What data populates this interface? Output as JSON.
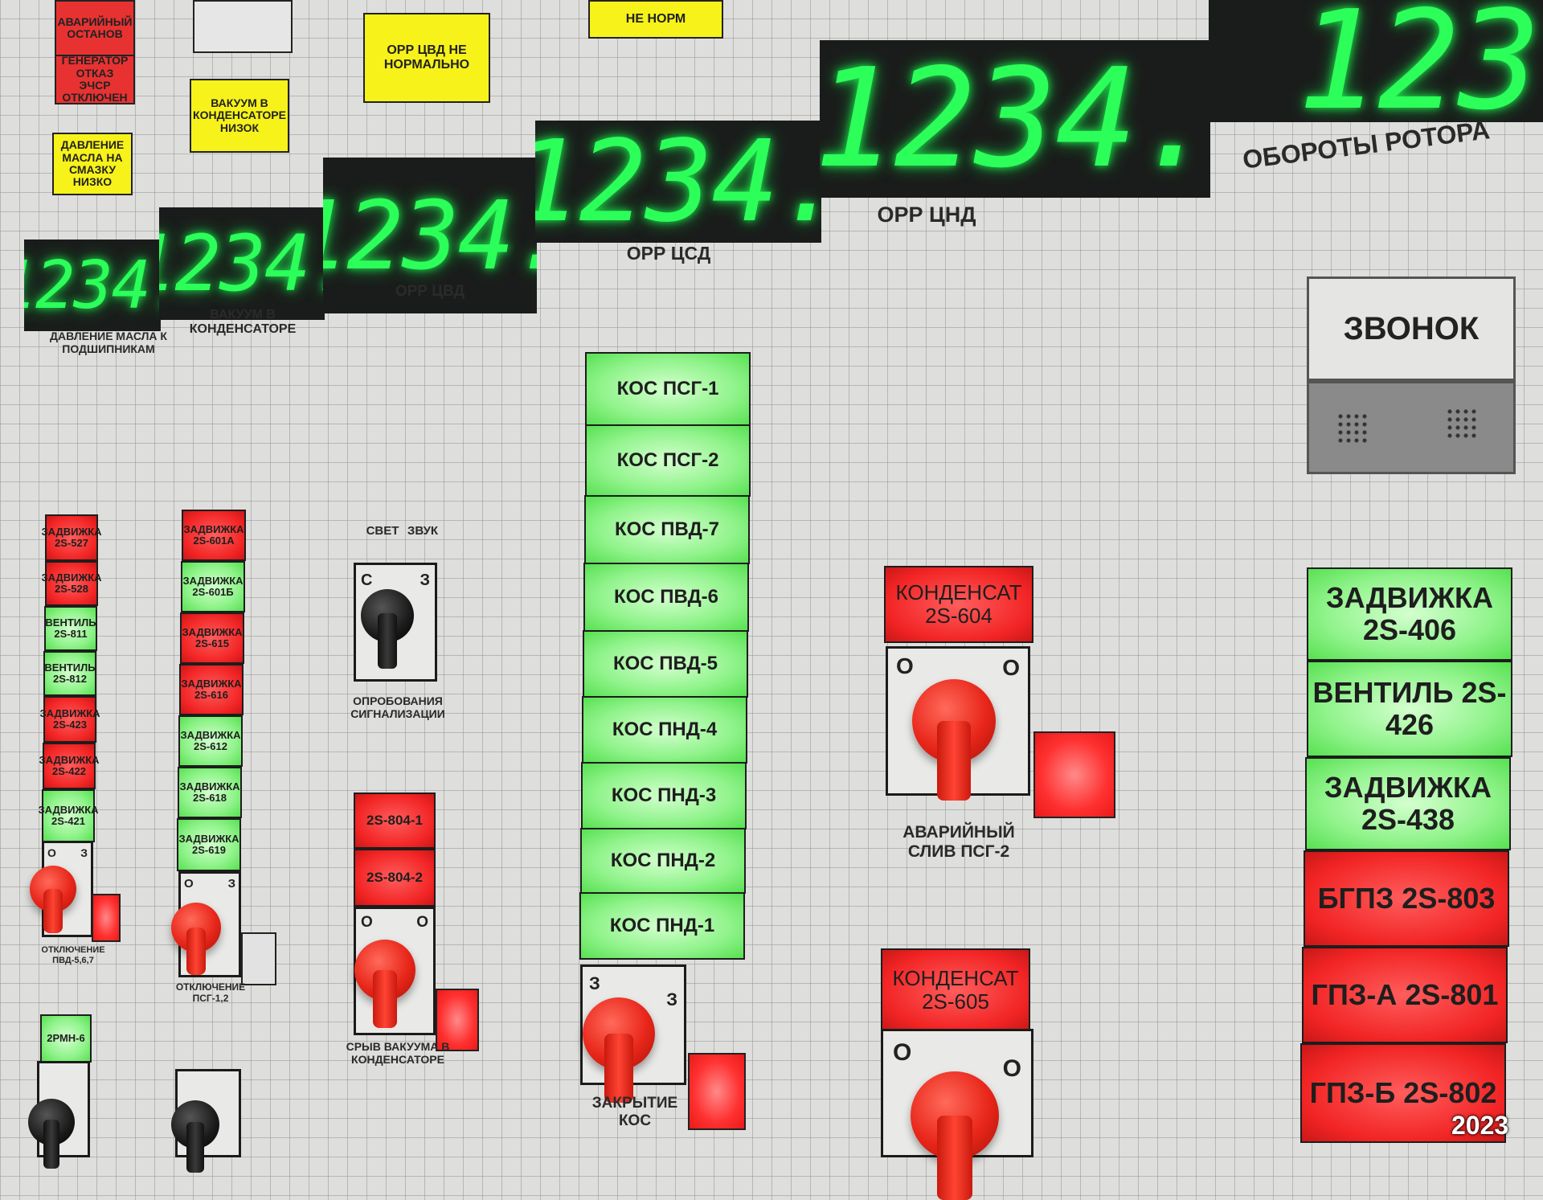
{
  "alarms": {
    "a1": "АВАРИЙНЫЙ ОСТАНОВ",
    "a2": "ГЕНЕРАТОР ОТКАЗ ЭЧСР ОТКЛЮЧЕН",
    "a3": "ДАВЛЕНИЕ МАСЛА НА СМАЗКУ НИЗКО",
    "a4": "ВАКУУМ В КОНДЕНСАТОРЕ НИЗОК",
    "a5": "ОРР ЦВД НЕ НОРМАЛЬНО",
    "a6": "НЕ НОРМ"
  },
  "displays": [
    {
      "value": "1234.",
      "caption": "ДАВЛЕНИЕ МАСЛА К ПОДШИПНИКАМ"
    },
    {
      "value": "1234.",
      "caption": "ВАКУУМ В КОНДЕНСАТОРЕ"
    },
    {
      "value": "1234.",
      "caption": "ОРР ЦВД"
    },
    {
      "value": "1234.",
      "caption": "ОРР ЦСД"
    },
    {
      "value": "1234.",
      "caption": "ОРР ЦНД"
    },
    {
      "value": "123",
      "caption": "ОБОРОТЫ РОТОРА"
    }
  ],
  "col1": {
    "tiles": [
      "ЗАДВИЖКА 2S-527",
      "ЗАДВИЖКА 2S-528",
      "ВЕНТИЛЬ 2S-811",
      "ВЕНТИЛЬ 2S-812",
      "ЗАДВИЖКА 2S-423",
      "ЗАДВИЖКА 2S-422",
      "ЗАДВИЖКА 2S-421"
    ],
    "switch_marks": [
      "О",
      "З"
    ],
    "switch_caption": "ОТКЛЮЧЕНИЕ ПВД-5,6,7",
    "bottom_tile": "2РМН-6"
  },
  "col2": {
    "tiles": [
      "ЗАДВИЖКА 2S-601А",
      "ЗАДВИЖКА 2S-601Б",
      "ЗАДВИЖКА 2S-615",
      "ЗАДВИЖКА 2S-616",
      "ЗАДВИЖКА 2S-612",
      "ЗАДВИЖКА 2S-618",
      "ЗАДВИЖКА 2S-619"
    ],
    "switch_marks": [
      "О",
      "З"
    ],
    "switch_caption": "ОТКЛЮЧЕНИЕ ПСГ-1,2"
  },
  "signal": {
    "header_left": "СВЕТ",
    "header_right": "ЗВУК",
    "mark_left": "С",
    "mark_right": "З",
    "caption": "ОПРОБОВАНИЯ СИГНАЛИЗАЦИИ"
  },
  "vac": {
    "tiles": [
      "2S-804-1",
      "2S-804-2"
    ],
    "switch_marks": [
      "О",
      "О"
    ],
    "caption": "СРЫВ ВАКУУМА В КОНДЕНСАТОРЕ"
  },
  "kos": {
    "tiles": [
      "КОС ПСГ-1",
      "КОС ПСГ-2",
      "КОС ПВД-7",
      "КОС ПВД-6",
      "КОС ПВД-5",
      "КОС ПНД-4",
      "КОС ПНД-3",
      "КОС ПНД-2",
      "КОС ПНД-1"
    ],
    "switch_marks": [
      "З",
      "З"
    ],
    "caption": "ЗАКРЫТИЕ КОС"
  },
  "cond": {
    "tile1": "КОНДЕНСАТ 2S-604",
    "switch_marks": [
      "О",
      "О"
    ],
    "caption": "АВАРИЙНЫЙ СЛИВ ПСГ-2",
    "tile2": "КОНДЕНСАТ 2S-605",
    "switch2_marks": [
      "О",
      "О"
    ]
  },
  "bell": {
    "label": "ЗВОНОК"
  },
  "right": {
    "tiles": [
      {
        "text": "ЗАДВИЖКА 2S-406",
        "color": "green"
      },
      {
        "text": "ВЕНТИЛЬ 2S-426",
        "color": "green"
      },
      {
        "text": "ЗАДВИЖКА 2S-438",
        "color": "green"
      },
      {
        "text": "БГПЗ 2S-803",
        "color": "red"
      },
      {
        "text": "ГПЗ-А 2S-801",
        "color": "red"
      },
      {
        "text": "ГПЗ-Б 2S-802",
        "color": "red"
      }
    ]
  },
  "year": "2023"
}
